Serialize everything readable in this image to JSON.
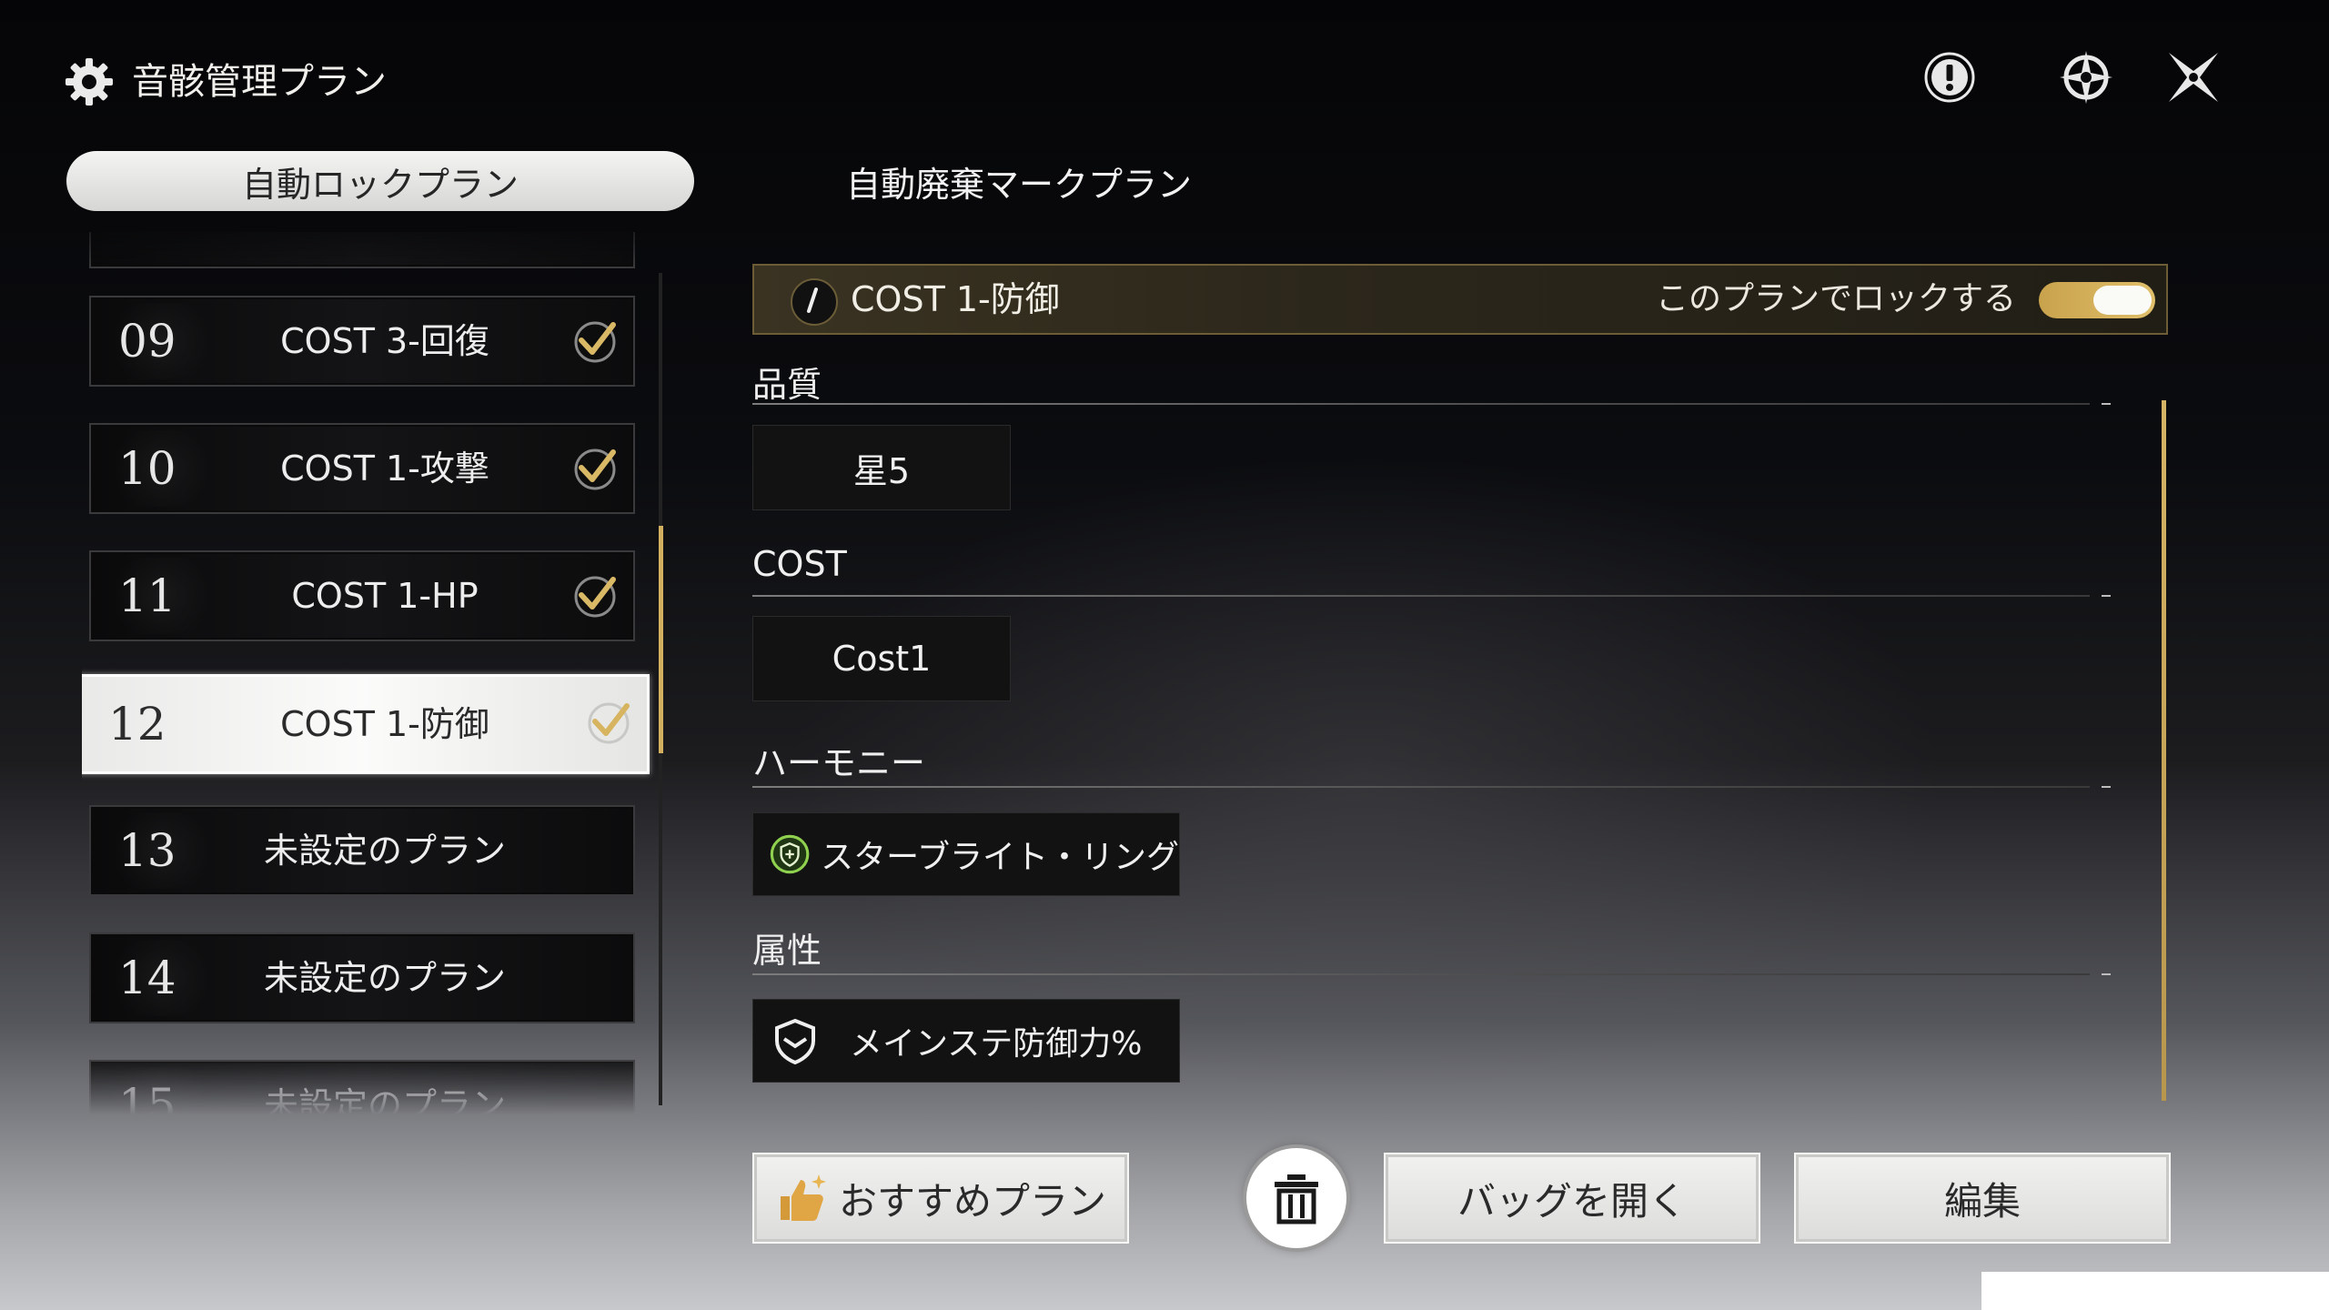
{
  "header": {
    "title": "音骸管理プラン",
    "icons": [
      "gear-icon",
      "exclamation-icon",
      "compass-icon",
      "close-icon"
    ]
  },
  "tabs": [
    {
      "label": "自動ロックプラン",
      "active": true
    },
    {
      "label": "自動廃棄マークプラン",
      "active": false
    }
  ],
  "plans": [
    {
      "num": "09",
      "label": "COST 3-回復",
      "checked": true,
      "selected": false
    },
    {
      "num": "10",
      "label": "COST 1-攻撃",
      "checked": true,
      "selected": false
    },
    {
      "num": "11",
      "label": "COST 1-HP",
      "checked": true,
      "selected": false
    },
    {
      "num": "12",
      "label": "COST 1-防御",
      "checked": true,
      "selected": true
    },
    {
      "num": "13",
      "label": "未設定のプラン",
      "checked": false,
      "selected": false
    },
    {
      "num": "14",
      "label": "未設定のプラン",
      "checked": false,
      "selected": false
    },
    {
      "num": "15",
      "label": "未設定のプラン",
      "checked": false,
      "selected": false
    }
  ],
  "detail": {
    "title": "COST 1-防御",
    "lock_label": "このプランでロックする",
    "lock_enabled": true,
    "sections": {
      "quality": {
        "title": "品質",
        "value": "星5"
      },
      "cost": {
        "title": "COST",
        "value": "Cost1"
      },
      "harmony": {
        "title": "ハーモニー",
        "value": "スターブライト・リング",
        "icon": "shield-plus-icon"
      },
      "attribute": {
        "title": "属性",
        "value": "メインステ防御力%",
        "icon": "shield-icon"
      }
    }
  },
  "buttons": {
    "recommend": "おすすめプラン",
    "open_bag": "バッグを開く",
    "edit": "編集",
    "delete_icon": "trash-icon"
  },
  "colors": {
    "accent_gold": "#d6b466",
    "selected_item": "#f4f4f2",
    "harmony_green": "#8fd14f"
  }
}
